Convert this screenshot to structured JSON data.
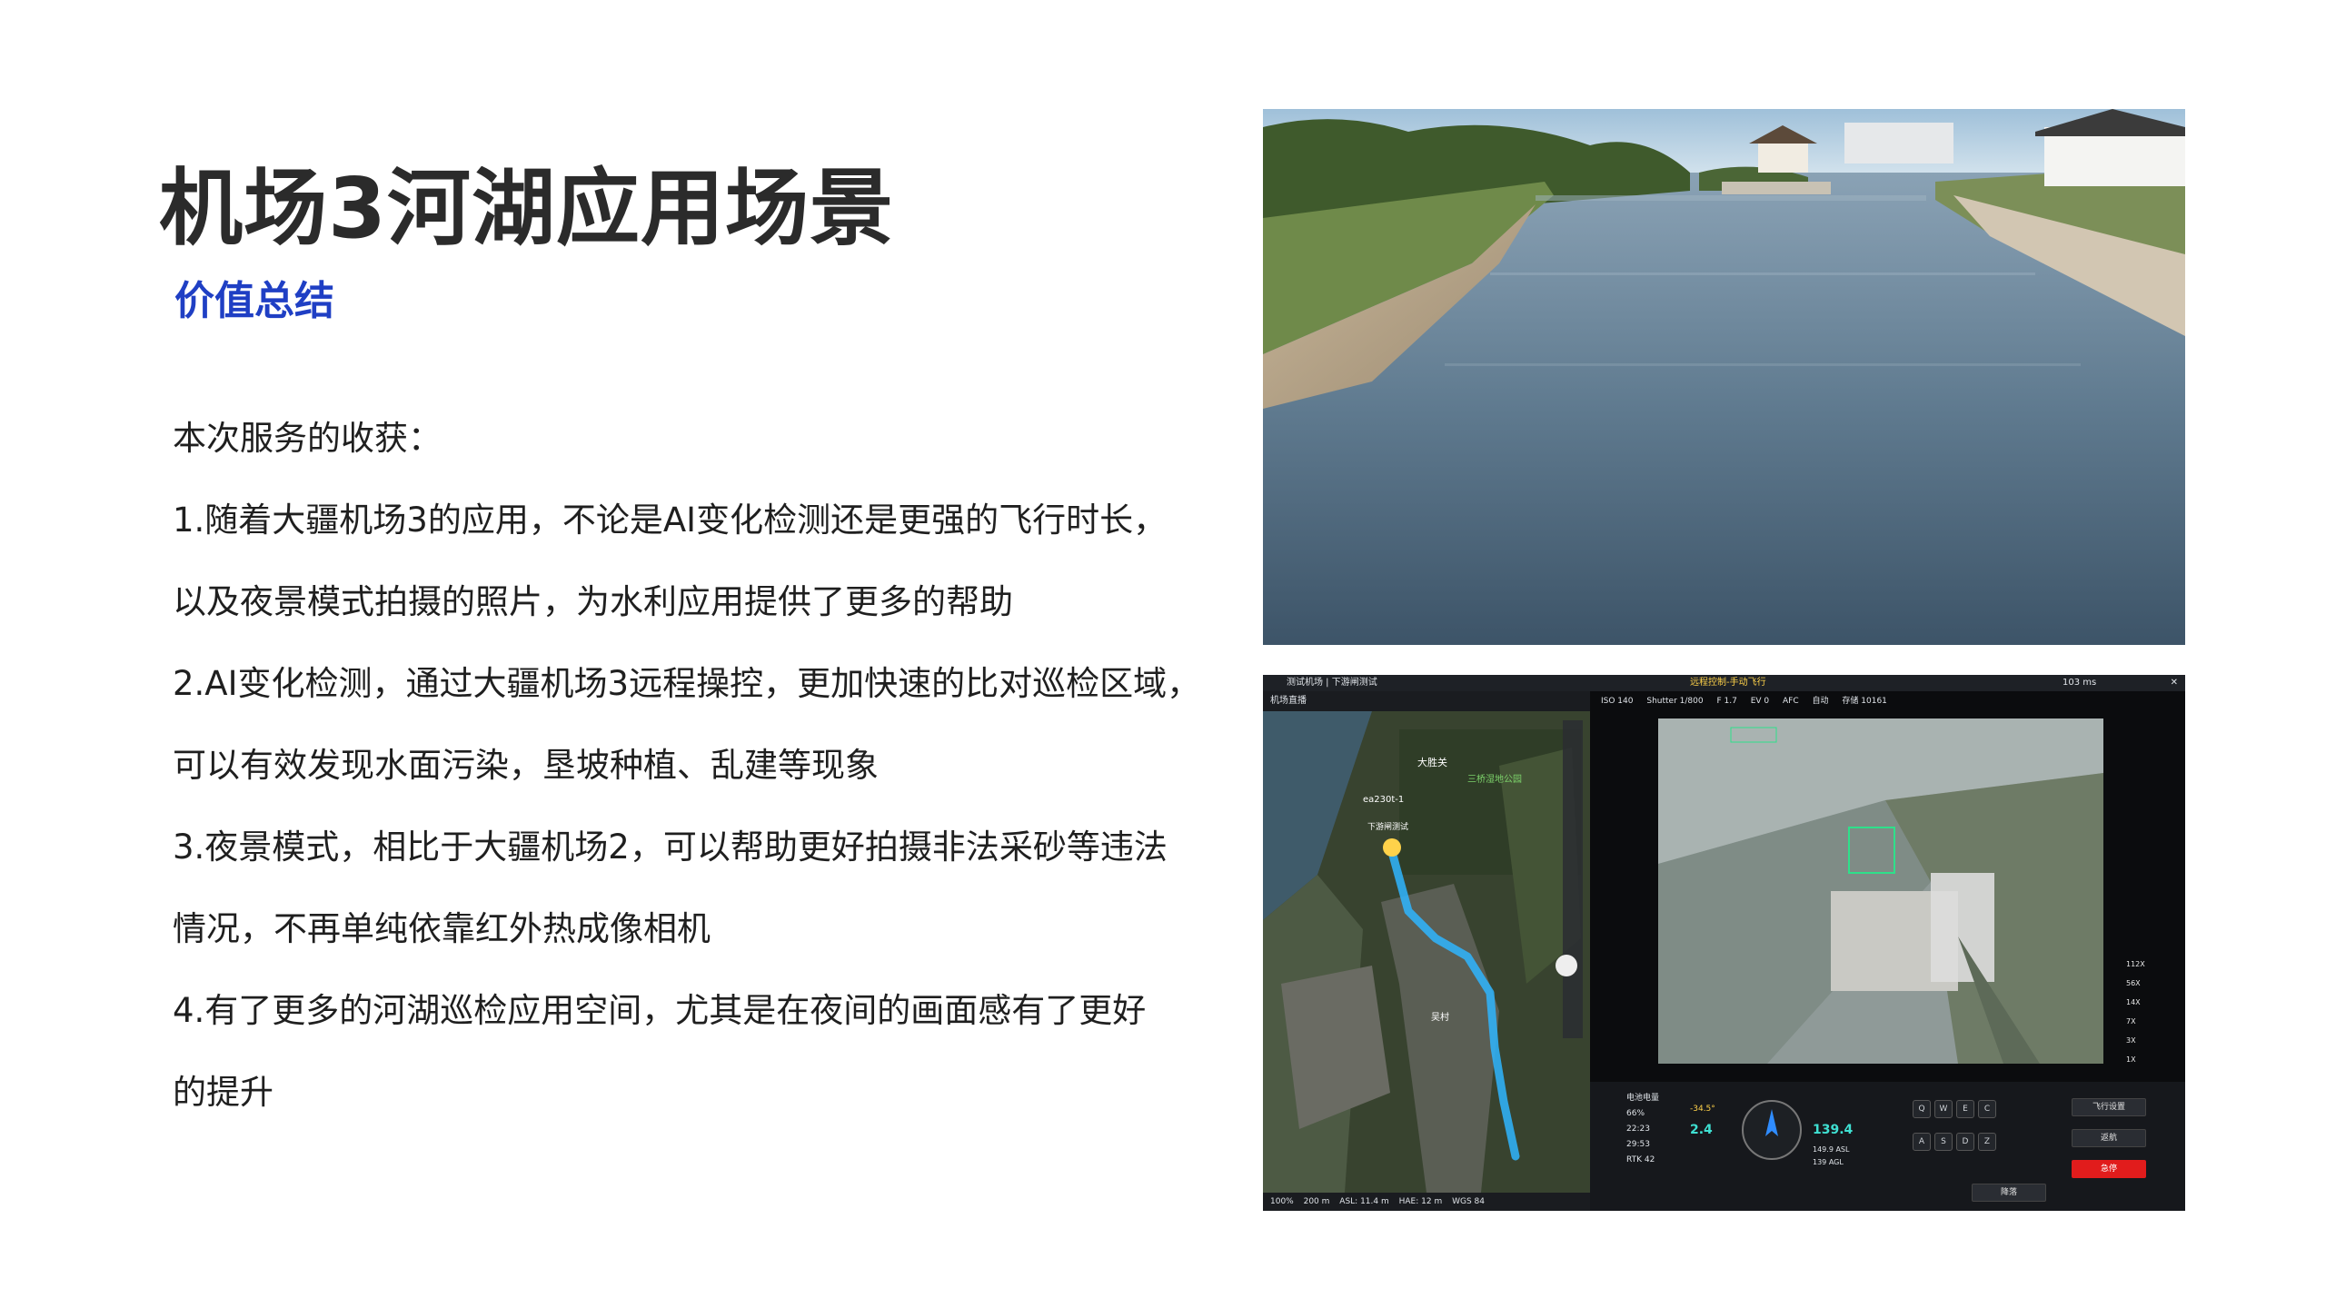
{
  "title": "机场3河湖应用场景",
  "subtitle": "价值总结",
  "body": {
    "lines": [
      "本次服务的收获：",
      "1.随着大疆机场3的应用，不论是AI变化检测还是更强的飞行时长，",
      "以及夜景模式拍摄的照片，为水利应用提供了更多的帮助",
      "2.AI变化检测，通过大疆机场3远程操控，更加快速的比对巡检区域，",
      "可以有效发现水面污染，垦坡种植、乱建等现象",
      "3.夜景模式，相比于大疆机场2，可以帮助更好拍摄非法采砂等违法",
      "情况，不再单纯依靠红外热成像相机",
      "4.有了更多的河湖巡检应用空间，尤其是在夜间的画面感有了更好",
      "的提升"
    ]
  },
  "drone_ui": {
    "topbar_left": "测试机场 | 下游闸测试",
    "topbar_mid": "远程控制-手动飞行",
    "topbar_right": "103 ms",
    "panel_title": "机场直播",
    "camera_bar": [
      "ISO 140",
      "Shutter 1/800",
      "F 1.7",
      "EV 0",
      "AFC",
      "自动",
      "存储 10161"
    ],
    "map_labels": [
      "大胜关",
      "三桥湿地公园",
      "ea230t-1",
      "下游闸测试",
      "吴村"
    ],
    "map_status": [
      "100%",
      "200 m",
      "ASL: 11.4 m",
      "HAE: 12 m",
      "WGS 84"
    ],
    "zoom_levels": [
      "112X",
      "56X",
      "14X",
      "7X",
      "3X",
      "1X"
    ],
    "stats": [
      "电池电量",
      "66%",
      "22:23",
      "29:53",
      "RTK 42"
    ],
    "speed": "2.4",
    "altitude": "139.4",
    "heading": "-34.5°",
    "alt_asl": "149.9 ASL",
    "alt_agl": "139 AGL",
    "keys": [
      "Q",
      "W",
      "E",
      "C",
      "A",
      "S",
      "D",
      "Z"
    ],
    "buttons": [
      "飞行设置",
      "返航",
      "急停",
      "降落"
    ],
    "colors": {
      "route": "#2fb5ff",
      "alert": "#e11c1c",
      "accent": "#3fe0d2"
    }
  }
}
